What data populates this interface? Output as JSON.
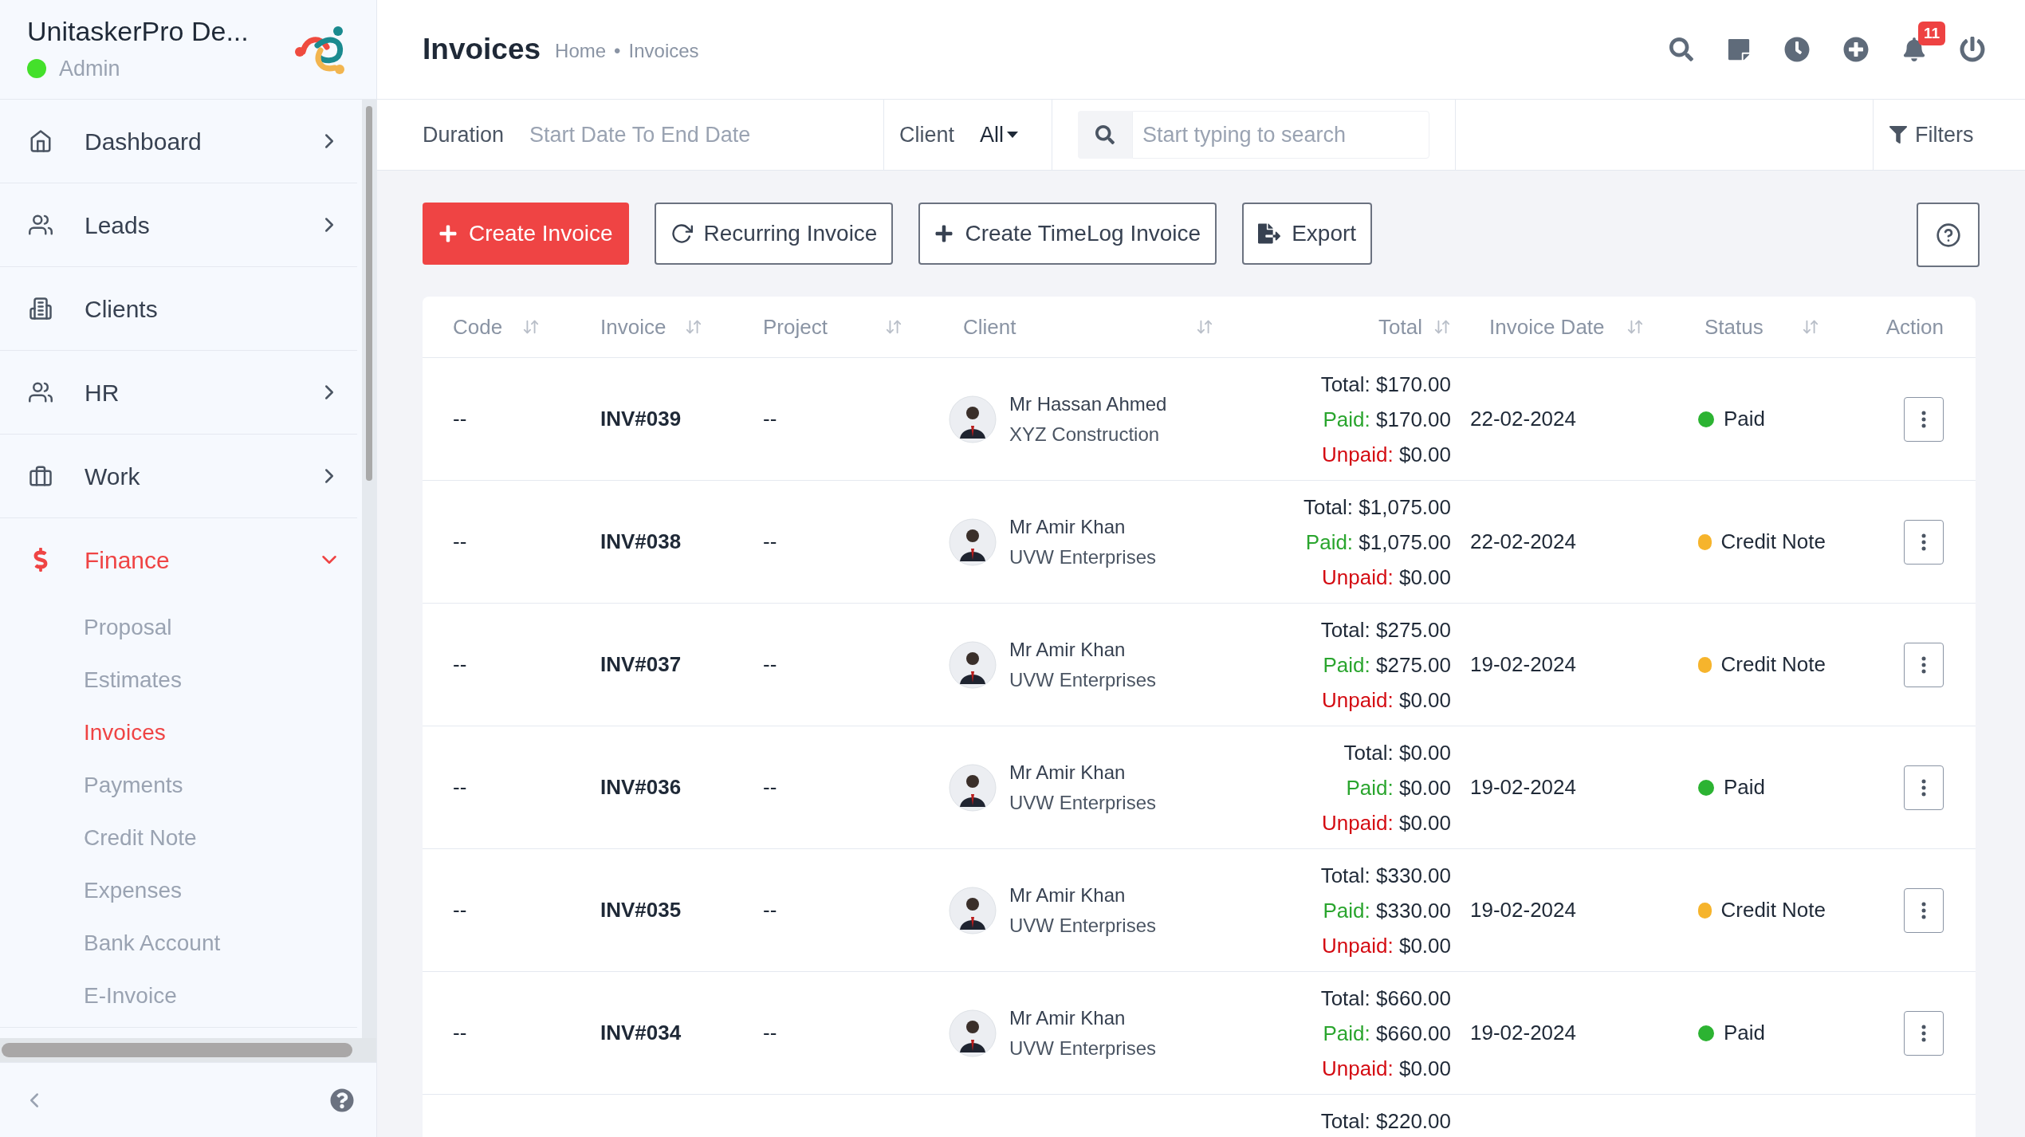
{
  "brand": {
    "name": "UnitaskerPro De...",
    "role": "Admin",
    "online": true
  },
  "sidebar": {
    "items": [
      {
        "label": "Dashboard",
        "kind": "group",
        "selected": false,
        "expanded": false
      },
      {
        "label": "Leads",
        "kind": "group",
        "selected": false,
        "expanded": false
      },
      {
        "label": "Clients",
        "kind": "link",
        "selected": false,
        "expanded": false
      },
      {
        "label": "HR",
        "kind": "group",
        "selected": false,
        "expanded": false
      },
      {
        "label": "Work",
        "kind": "group",
        "selected": false,
        "expanded": false
      },
      {
        "label": "Finance",
        "kind": "group",
        "selected": true,
        "expanded": true,
        "children": [
          {
            "label": "Proposal",
            "selected": false
          },
          {
            "label": "Estimates",
            "selected": false
          },
          {
            "label": "Invoices",
            "selected": true
          },
          {
            "label": "Payments",
            "selected": false
          },
          {
            "label": "Credit Note",
            "selected": false
          },
          {
            "label": "Expenses",
            "selected": false
          },
          {
            "label": "Bank Account",
            "selected": false
          },
          {
            "label": "E-Invoice",
            "selected": false
          }
        ]
      }
    ]
  },
  "header": {
    "title": "Invoices",
    "breadcrumb": {
      "items": [
        "Home",
        "Invoices"
      ],
      "separator": "•"
    },
    "notifications": "11"
  },
  "filter_bar": {
    "duration_label": "Duration",
    "duration_value": "Start Date To End Date",
    "client_label": "Client",
    "client_value": "All",
    "search": {
      "placeholder": "Start typing to search"
    },
    "filters_button": "Filters"
  },
  "actions": [
    {
      "label": "Create Invoice",
      "kind": "primary"
    },
    {
      "label": "Recurring Invoice",
      "kind": "outline"
    },
    {
      "label": "Create TimeLog Invoice",
      "kind": "outline"
    },
    {
      "label": "Export",
      "kind": "outline"
    }
  ],
  "table": {
    "columns": [
      {
        "label": "Code"
      },
      {
        "label": "Invoice"
      },
      {
        "label": "Project"
      },
      {
        "label": "Client"
      },
      {
        "label": "Total"
      },
      {
        "label": "Invoice Date"
      },
      {
        "label": "Status"
      },
      {
        "label": "Action"
      }
    ],
    "rows": [
      {
        "code": "--",
        "invoice": "INV#039",
        "project": "--",
        "client": {
          "name": "Mr Hassan Ahmed",
          "company": "XYZ Construction"
        },
        "amounts": [
          {
            "kind": "total",
            "label": "Total:",
            "value": "$170.00"
          },
          {
            "kind": "paid",
            "label": "Paid:",
            "value": "$170.00"
          },
          {
            "kind": "unpaid",
            "label": "Unpaid:",
            "value": "$0.00"
          }
        ],
        "date": "22-02-2024",
        "status": {
          "label": "Paid",
          "color": "#2cb332"
        }
      },
      {
        "code": "--",
        "invoice": "INV#038",
        "project": "--",
        "client": {
          "name": "Mr Amir Khan",
          "company": "UVW Enterprises"
        },
        "amounts": [
          {
            "kind": "total",
            "label": "Total:",
            "value": "$1,075.00"
          },
          {
            "kind": "paid",
            "label": "Paid:",
            "value": "$1,075.00"
          },
          {
            "kind": "unpaid",
            "label": "Unpaid:",
            "value": "$0.00"
          }
        ],
        "date": "22-02-2024",
        "status": {
          "label": "Credit Note",
          "color": "#f6b42c"
        }
      },
      {
        "code": "--",
        "invoice": "INV#037",
        "project": "--",
        "client": {
          "name": "Mr Amir Khan",
          "company": "UVW Enterprises"
        },
        "amounts": [
          {
            "kind": "total",
            "label": "Total:",
            "value": "$275.00"
          },
          {
            "kind": "paid",
            "label": "Paid:",
            "value": "$275.00"
          },
          {
            "kind": "unpaid",
            "label": "Unpaid:",
            "value": "$0.00"
          }
        ],
        "date": "19-02-2024",
        "status": {
          "label": "Credit Note",
          "color": "#f6b42c"
        }
      },
      {
        "code": "--",
        "invoice": "INV#036",
        "project": "--",
        "client": {
          "name": "Mr Amir Khan",
          "company": "UVW Enterprises"
        },
        "amounts": [
          {
            "kind": "total",
            "label": "Total:",
            "value": "$0.00"
          },
          {
            "kind": "paid",
            "label": "Paid:",
            "value": "$0.00"
          },
          {
            "kind": "unpaid",
            "label": "Unpaid:",
            "value": "$0.00"
          }
        ],
        "date": "19-02-2024",
        "status": {
          "label": "Paid",
          "color": "#2cb332"
        }
      },
      {
        "code": "--",
        "invoice": "INV#035",
        "project": "--",
        "client": {
          "name": "Mr Amir Khan",
          "company": "UVW Enterprises"
        },
        "amounts": [
          {
            "kind": "total",
            "label": "Total:",
            "value": "$330.00"
          },
          {
            "kind": "paid",
            "label": "Paid:",
            "value": "$330.00"
          },
          {
            "kind": "unpaid",
            "label": "Unpaid:",
            "value": "$0.00"
          }
        ],
        "date": "19-02-2024",
        "status": {
          "label": "Credit Note",
          "color": "#f6b42c"
        }
      },
      {
        "code": "--",
        "invoice": "INV#034",
        "project": "--",
        "client": {
          "name": "Mr Amir Khan",
          "company": "UVW Enterprises"
        },
        "amounts": [
          {
            "kind": "total",
            "label": "Total:",
            "value": "$660.00"
          },
          {
            "kind": "paid",
            "label": "Paid:",
            "value": "$660.00"
          },
          {
            "kind": "unpaid",
            "label": "Unpaid:",
            "value": "$0.00"
          }
        ],
        "date": "19-02-2024",
        "status": {
          "label": "Paid",
          "color": "#2cb332"
        }
      },
      {
        "amounts": [
          {
            "kind": "total",
            "label": "Total:",
            "value": "$220.00"
          }
        ]
      }
    ]
  }
}
